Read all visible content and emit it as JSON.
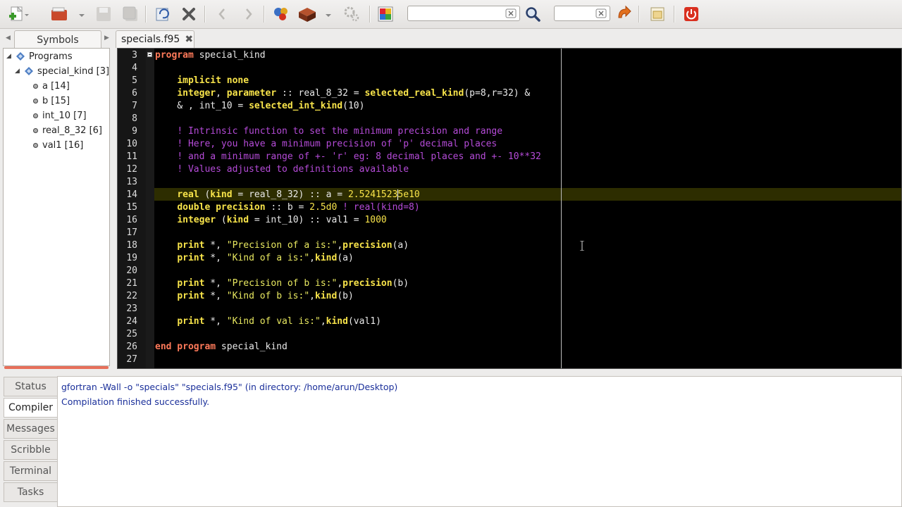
{
  "toolbar": {
    "buttons": [
      {
        "name": "new-file-icon"
      },
      {
        "name": "open-file-icon"
      },
      {
        "name": "save-icon"
      },
      {
        "name": "save-all-icon"
      },
      {
        "name": "revert-icon"
      },
      {
        "name": "close-icon"
      },
      {
        "name": "back-icon"
      },
      {
        "name": "forward-icon"
      },
      {
        "name": "compile-icon"
      },
      {
        "name": "build-icon"
      },
      {
        "name": "execute-icon"
      },
      {
        "name": "color-chooser-icon"
      },
      {
        "name": "search-icon"
      },
      {
        "name": "jump-to-line-icon"
      },
      {
        "name": "preferences-icon"
      },
      {
        "name": "quit-icon"
      }
    ],
    "search_value": "",
    "goto_value": ""
  },
  "sidebar": {
    "tab_label": "Symbols",
    "tree": [
      {
        "label": "Programs",
        "level": 0,
        "expanded": true,
        "kind": "group"
      },
      {
        "label": "special_kind [3]",
        "level": 1,
        "expanded": true,
        "kind": "program"
      },
      {
        "label": "a [14]",
        "level": 2,
        "kind": "variable"
      },
      {
        "label": "b [15]",
        "level": 2,
        "kind": "variable"
      },
      {
        "label": "int_10 [7]",
        "level": 2,
        "kind": "variable"
      },
      {
        "label": "real_8_32 [6]",
        "level": 2,
        "kind": "variable"
      },
      {
        "label": "val1 [16]",
        "level": 2,
        "kind": "variable"
      }
    ]
  },
  "editor": {
    "tab_label": "specials.f95",
    "current_line": 14,
    "lines": [
      {
        "n": "3",
        "html": "<span class=\"k-prog\">program</span> special_kind"
      },
      {
        "n": "4",
        "html": ""
      },
      {
        "n": "5",
        "html": "    <span class=\"k-decl\">implicit none</span>"
      },
      {
        "n": "6",
        "html": "    <span class=\"k-decl\">integer</span>, <span class=\"k-decl\">parameter</span> :: real_8_32 = <span class=\"k-intr\">selected_real_kind</span>(p=8,r=32) &amp;"
      },
      {
        "n": "7",
        "html": "    &amp; , int_10 = <span class=\"k-intr\">selected_int_kind</span>(10)"
      },
      {
        "n": "8",
        "html": ""
      },
      {
        "n": "9",
        "html": "    <span class=\"cmt\">! Intrinsic function to set the minimum precision and range</span>"
      },
      {
        "n": "10",
        "html": "    <span class=\"cmt\">! Here, you have a minimum precision of 'p' decimal places</span>"
      },
      {
        "n": "11",
        "html": "    <span class=\"cmt\">! and a minimum range of +- 'r' eg: 8 decimal places and +- 10**32</span>"
      },
      {
        "n": "12",
        "html": "    <span class=\"cmt\">! Values adjusted to definitions available</span>"
      },
      {
        "n": "13",
        "html": ""
      },
      {
        "n": "14",
        "html": "    <span class=\"k-decl\">real</span> (<span class=\"k-decl\">kind</span> = real_8_32) :: a = <span class=\"num\">2.5241523<span class=\"caret\"></span>5e10</span>"
      },
      {
        "n": "15",
        "html": "    <span class=\"k-decl\">double precision</span> :: b = <span class=\"num\">2.5d0</span> <span class=\"cmt\">! real(kind=8)</span>"
      },
      {
        "n": "16",
        "html": "    <span class=\"k-decl\">integer</span> (<span class=\"k-decl\">kind</span> = int_10) :: val1 = <span class=\"num\">1000</span>"
      },
      {
        "n": "17",
        "html": ""
      },
      {
        "n": "18",
        "html": "    <span class=\"k-print\">print</span> *, <span class=\"str\">\"Precision of a is:\"</span>,<span class=\"k-intr\">precision</span>(a)"
      },
      {
        "n": "19",
        "html": "    <span class=\"k-print\">print</span> *, <span class=\"str\">\"Kind of a is:\"</span>,<span class=\"k-intr\">kind</span>(a)"
      },
      {
        "n": "20",
        "html": ""
      },
      {
        "n": "21",
        "html": "    <span class=\"k-print\">print</span> *, <span class=\"str\">\"Precision of b is:\"</span>,<span class=\"k-intr\">precision</span>(b)"
      },
      {
        "n": "22",
        "html": "    <span class=\"k-print\">print</span> *, <span class=\"str\">\"Kind of b is:\"</span>,<span class=\"k-intr\">kind</span>(b)"
      },
      {
        "n": "23",
        "html": ""
      },
      {
        "n": "24",
        "html": "    <span class=\"k-print\">print</span> *, <span class=\"str\">\"Kind of val is:\"</span>,<span class=\"k-intr\">kind</span>(val1)"
      },
      {
        "n": "25",
        "html": ""
      },
      {
        "n": "26",
        "html": "<span class=\"k-prog\">end program</span> special_kind"
      },
      {
        "n": "27",
        "html": ""
      }
    ]
  },
  "bottom_panel": {
    "tabs": [
      {
        "label": "Status",
        "active": false
      },
      {
        "label": "Compiler",
        "active": true
      },
      {
        "label": "Messages",
        "active": false
      },
      {
        "label": "Scribble",
        "active": false
      },
      {
        "label": "Terminal",
        "active": false
      },
      {
        "label": "Tasks",
        "active": false
      }
    ],
    "messages": [
      "gfortran -Wall -o \"specials\" \"specials.f95\" (in directory: /home/arun/Desktop)",
      "Compilation finished successfully."
    ]
  },
  "colors": {
    "editor_bg": "#000000",
    "keyword": "#f8e44a",
    "program_keyword": "#ff7a5a",
    "comment": "#b54bd8",
    "message_text": "#1a2f9a",
    "accent_red": "#d9301f"
  }
}
